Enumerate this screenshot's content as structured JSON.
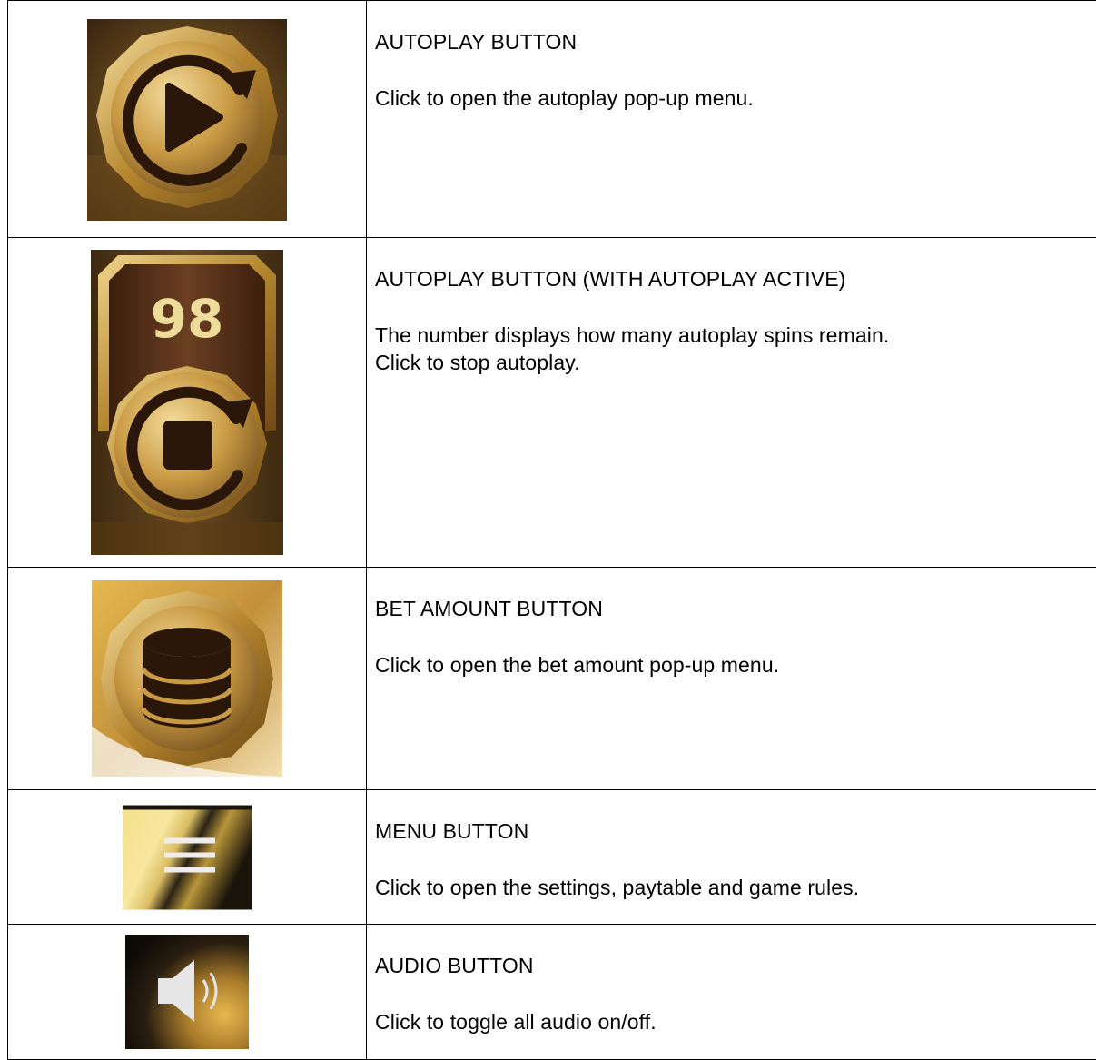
{
  "rows": [
    {
      "icon": "autoplay-icon",
      "title": "AUTOPLAY BUTTON",
      "lines": [
        "Click to open the autoplay pop-up menu."
      ]
    },
    {
      "icon": "autoplay-active-icon",
      "badge": "98",
      "title": "AUTOPLAY BUTTON (WITH AUTOPLAY ACTIVE)",
      "lines": [
        "The number displays how many autoplay spins remain.",
        "Click to stop autoplay."
      ]
    },
    {
      "icon": "bet-amount-icon",
      "title": "BET AMOUNT BUTTON",
      "lines": [
        "Click to open the bet amount pop-up menu."
      ]
    },
    {
      "icon": "menu-icon",
      "title": "MENU BUTTON",
      "lines": [
        "Click to open the settings, paytable and game rules."
      ]
    },
    {
      "icon": "audio-icon",
      "title": "AUDIO BUTTON",
      "lines": [
        "Click to toggle all audio on/off."
      ]
    }
  ],
  "colors": {
    "gold": "#c8a04a",
    "gold_light": "#ecd18c",
    "gold_dark": "#7a5a1c",
    "bronze_bg": "#5a3a1a",
    "icon_dark": "#2a170a",
    "border": "#000000"
  }
}
